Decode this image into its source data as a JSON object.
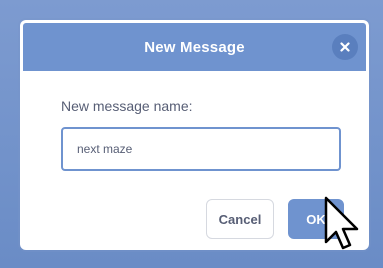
{
  "dialog": {
    "title": "New Message",
    "label": "New message name:",
    "input_value": "next maze",
    "cancel_label": "Cancel",
    "ok_label": "OK"
  },
  "icons": {
    "close": "close-icon",
    "cursor": "mouse-pointer-icon"
  },
  "colors": {
    "header": "#6f93cf",
    "accent": "#6f93cf",
    "text": "#575e75"
  }
}
